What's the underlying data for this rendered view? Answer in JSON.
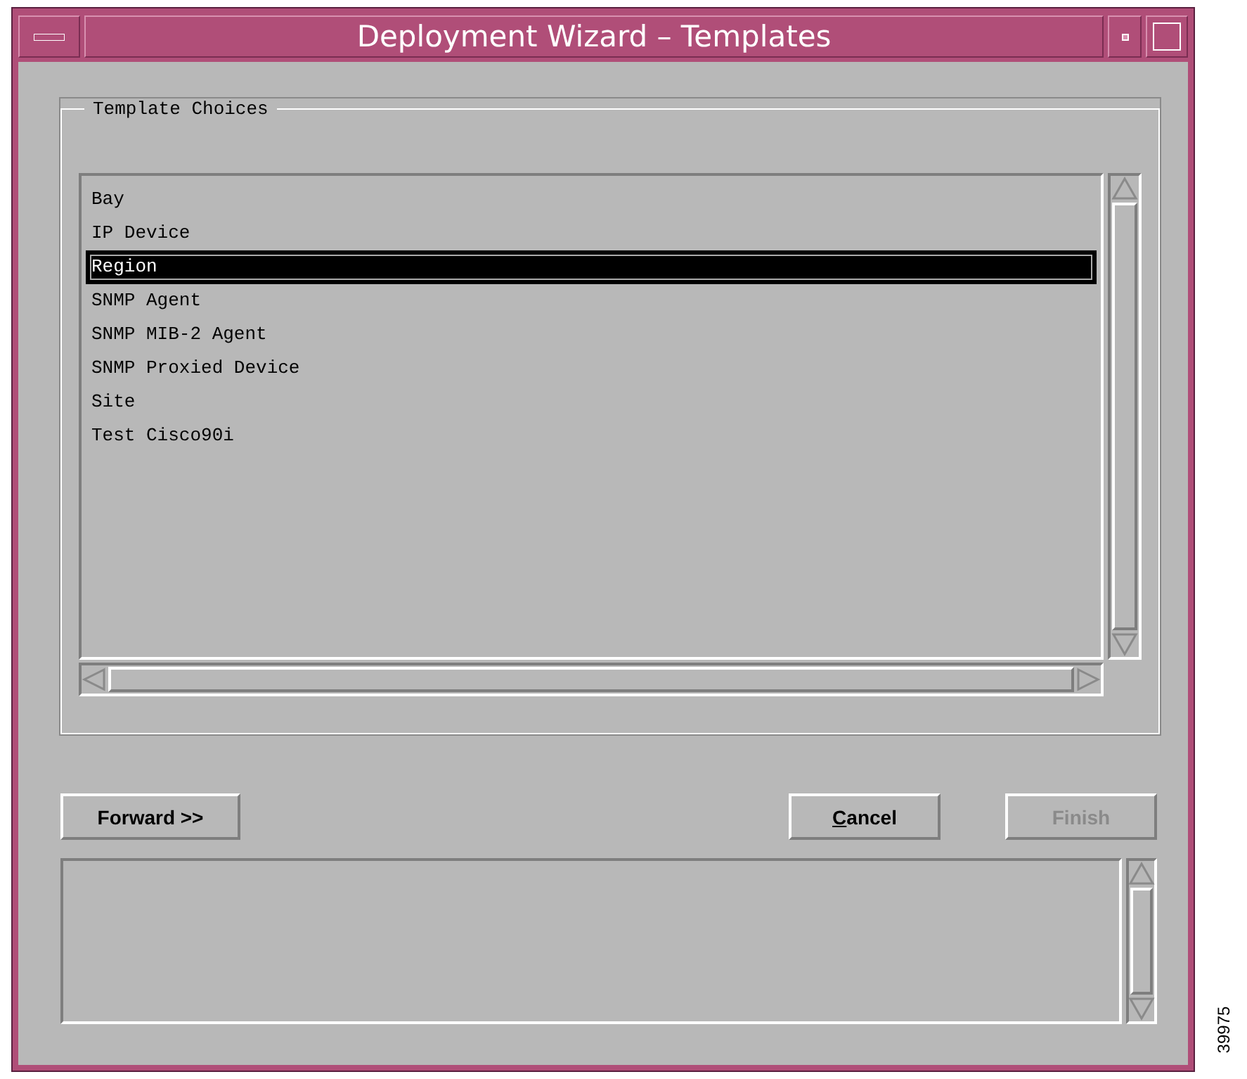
{
  "window": {
    "title": "Deployment Wizard – Templates"
  },
  "template_choices": {
    "legend": "Template Choices",
    "items": [
      {
        "label": "Bay",
        "selected": false
      },
      {
        "label": "IP Device",
        "selected": false
      },
      {
        "label": "Region",
        "selected": true
      },
      {
        "label": "SNMP Agent",
        "selected": false
      },
      {
        "label": "SNMP MIB-2 Agent",
        "selected": false
      },
      {
        "label": "SNMP Proxied Device",
        "selected": false
      },
      {
        "label": "Site",
        "selected": false
      },
      {
        "label": "Test Cisco90i",
        "selected": false
      }
    ]
  },
  "navigation_buttons": [
    {
      "label": "Forward >>",
      "disabled": false
    }
  ],
  "action_buttons": [
    {
      "label": "Cancel",
      "disabled": false,
      "underline_first": true
    },
    {
      "label": "Finish",
      "disabled": true,
      "underline_first": false
    }
  ],
  "figure_id": "39975"
}
